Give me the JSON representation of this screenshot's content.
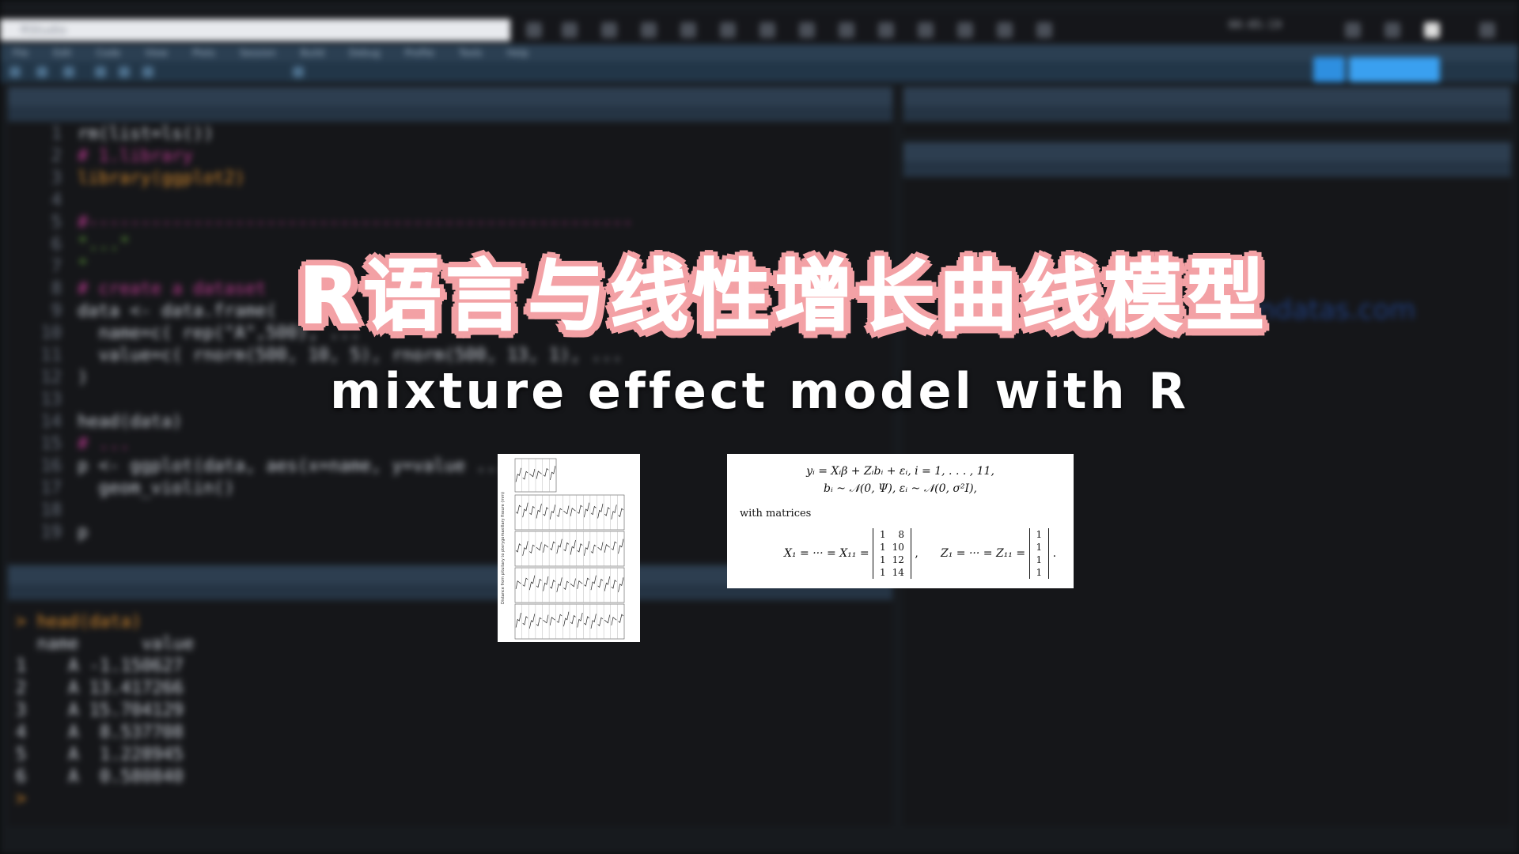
{
  "overlay": {
    "title_cn": "R语言与线性增长曲线模型",
    "subtitle_en": "mixture effect model with R"
  },
  "formula": {
    "line1_lhs": "y",
    "line1": "yᵢ = Xᵢβ + Zᵢbᵢ + εᵢ,    i = 1, . . . , 11,",
    "line2": "bᵢ ~ 𝒩(0, Ψ),    εᵢ ~ 𝒩(0, σ²I),",
    "with_text": "with matrices",
    "x_lhs": "X₁ = ··· = X₁₁ =",
    "x_matrix": [
      [
        "1",
        "8"
      ],
      [
        "1",
        "10"
      ],
      [
        "1",
        "12"
      ],
      [
        "1",
        "14"
      ]
    ],
    "z_lhs": "Z₁ = ··· = Z₁₁ =",
    "z_matrix": [
      [
        "1"
      ],
      [
        "1"
      ],
      [
        "1"
      ],
      [
        "1"
      ]
    ],
    "z_end": "."
  },
  "thumb": {
    "ylabel": "Distance from pituitary to pterygomaxillary fissure (mm)"
  },
  "ide": {
    "clock": "00:05:19",
    "menu": [
      "File",
      "Edit",
      "Code",
      "View",
      "Plots",
      "Session",
      "Build",
      "Debug",
      "Profile",
      "Tools",
      "Help"
    ],
    "code_lines": [
      {
        "n": "1",
        "t": "rm(list=ls())",
        "c": "white"
      },
      {
        "n": "2",
        "t": "# 1.library",
        "c": "cmt"
      },
      {
        "n": "3",
        "t": "library(ggplot2)",
        "c": "org"
      },
      {
        "n": "4",
        "t": "",
        "c": "white"
      },
      {
        "n": "5",
        "t": "#----------------------------------------------------",
        "c": "cmt"
      },
      {
        "n": "6",
        "t": "\"...\"",
        "c": "str"
      },
      {
        "n": "7",
        "t": "\"",
        "c": "str"
      },
      {
        "n": "8",
        "t": "# create a dataset",
        "c": "cmt"
      },
      {
        "n": "9",
        "t": "data <- data.frame(",
        "c": "white"
      },
      {
        "n": "10",
        "t": "  name=c( rep(\"A\",500), ...",
        "c": "white"
      },
      {
        "n": "11",
        "t": "  value=c( rnorm(500, 10, 5), rnorm(500, 13, 1), ...",
        "c": "white"
      },
      {
        "n": "12",
        "t": ")",
        "c": "white"
      },
      {
        "n": "13",
        "t": "",
        "c": "white"
      },
      {
        "n": "14",
        "t": "head(data)",
        "c": "white"
      },
      {
        "n": "15",
        "t": "# ...",
        "c": "cmt"
      },
      {
        "n": "16",
        "t": "p <- ggplot(data, aes(x=name, y=value ...",
        "c": "white"
      },
      {
        "n": "17",
        "t": "  geom_violin()",
        "c": "white"
      },
      {
        "n": "18",
        "t": "",
        "c": "white"
      },
      {
        "n": "19",
        "t": "p",
        "c": "white"
      }
    ],
    "console_lines": [
      {
        "t": "> head(data)",
        "c": "org"
      },
      {
        "t": "  name      value",
        "c": "white"
      },
      {
        "t": "1    A -1.150627",
        "c": "white"
      },
      {
        "t": "2    A 13.417266",
        "c": "white"
      },
      {
        "t": "3    A 15.704129",
        "c": "white"
      },
      {
        "t": "4    A  8.537708",
        "c": "white"
      },
      {
        "t": "5    A  1.228945",
        "c": "white"
      },
      {
        "t": "6    A  0.580840",
        "c": "white"
      },
      {
        "t": ">",
        "c": "org"
      }
    ],
    "url_fragment": "ndatas.com"
  }
}
